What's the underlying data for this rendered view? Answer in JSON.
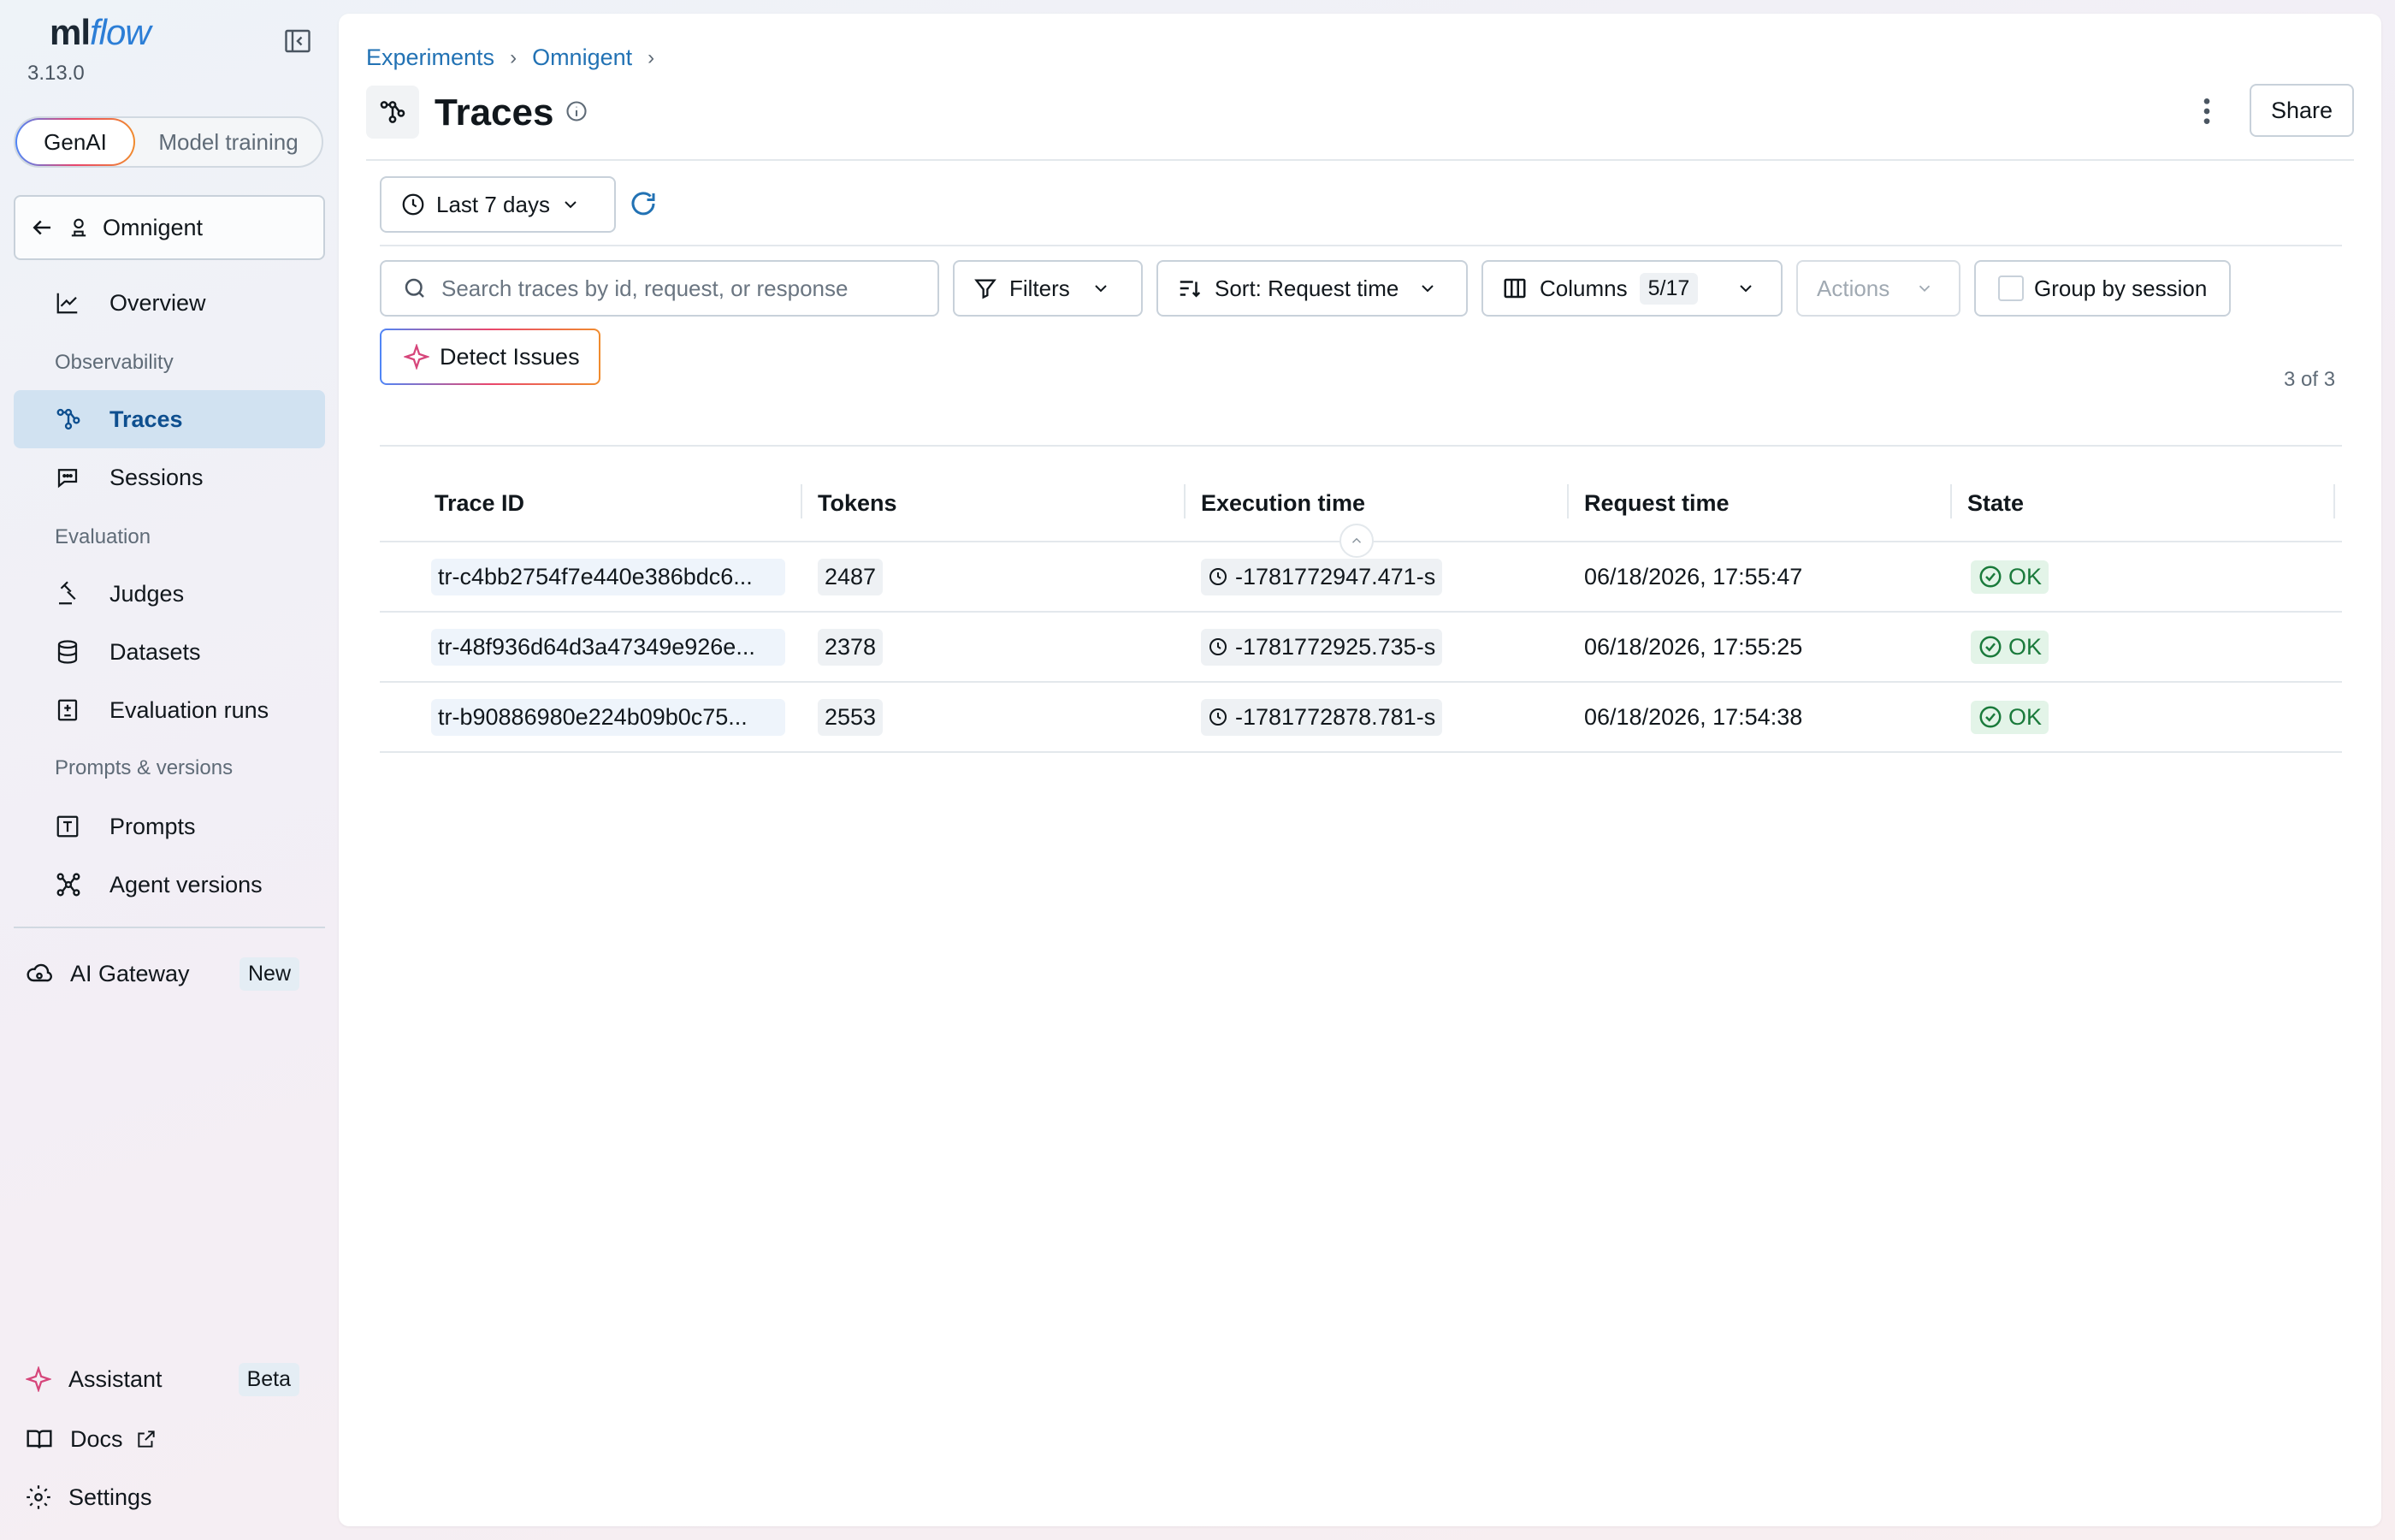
{
  "sidebar": {
    "logo_ml": "ml",
    "logo_flow": "flow",
    "version": "3.13.0",
    "modes": {
      "genai": "GenAI",
      "training": "Model training"
    },
    "experiment": "Omnigent",
    "items": {
      "overview": "Overview",
      "observability": "Observability",
      "traces": "Traces",
      "sessions": "Sessions",
      "evaluation": "Evaluation",
      "judges": "Judges",
      "datasets": "Datasets",
      "evaluation_runs": "Evaluation runs",
      "prompts_versions": "Prompts & versions",
      "prompts": "Prompts",
      "agent_versions": "Agent versions",
      "ai_gateway": "AI Gateway",
      "ai_gateway_badge": "New"
    },
    "bottom": {
      "assistant": "Assistant",
      "assistant_badge": "Beta",
      "docs": "Docs",
      "settings": "Settings"
    }
  },
  "header": {
    "breadcrumb": [
      "Experiments",
      "Omnigent"
    ],
    "breadcrumb_sep": "›",
    "title": "Traces",
    "share": "Share"
  },
  "toolbar": {
    "date_range": "Last 7 days",
    "search_placeholder": "Search traces by id, request, or response",
    "filters": "Filters",
    "sort": "Sort: Request time",
    "columns": "Columns",
    "columns_count": "5/17",
    "actions": "Actions",
    "group_by_session": "Group by session",
    "detect_issues": "Detect Issues",
    "row_count": "3 of 3"
  },
  "table": {
    "columns": [
      "Trace ID",
      "Tokens",
      "Execution time",
      "Request time",
      "State"
    ],
    "rows": [
      {
        "trace_id": "tr-c4bb2754f7e440e386bdc6...",
        "tokens": "2487",
        "execution_time": "-1781772947.471-s",
        "request_time": "06/18/2026, 17:55:47",
        "state": "OK"
      },
      {
        "trace_id": "tr-48f936d64d3a47349e926e...",
        "tokens": "2378",
        "execution_time": "-1781772925.735-s",
        "request_time": "06/18/2026, 17:55:25",
        "state": "OK"
      },
      {
        "trace_id": "tr-b90886980e224b09b0c75...",
        "tokens": "2553",
        "execution_time": "-1781772878.781-s",
        "request_time": "06/18/2026, 17:54:38",
        "state": "OK"
      }
    ]
  },
  "colors": {
    "accent": "#2272b4",
    "active_bg": "#d1e2f1",
    "ok": "#1a7a3b"
  }
}
